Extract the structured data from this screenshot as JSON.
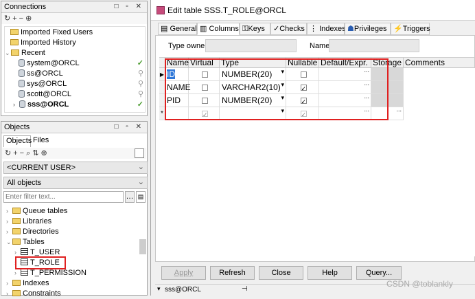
{
  "connections": {
    "title": "Connections",
    "panel_buttons": "□ ▫ ✕",
    "items": [
      {
        "label": "Imported Fixed Users"
      },
      {
        "label": "Imported History"
      },
      {
        "label": "Recent"
      },
      {
        "label": "system@ORCL"
      },
      {
        "label": "ss@ORCL"
      },
      {
        "label": "sys@ORCL"
      },
      {
        "label": "scott@ORCL"
      },
      {
        "label": "sss@ORCL"
      }
    ]
  },
  "objects": {
    "title": "Objects",
    "tabs": [
      "Objects",
      "Files"
    ],
    "user_combo": "<CURRENT USER>",
    "scope_combo": "All objects",
    "filter_placeholder": "Enter filter text...",
    "tree": [
      {
        "label": "Queue tables"
      },
      {
        "label": "Libraries"
      },
      {
        "label": "Directories"
      },
      {
        "label": "Tables"
      },
      {
        "label": "T_USER"
      },
      {
        "label": "T_ROLE"
      },
      {
        "label": "T_PERMISSION"
      },
      {
        "label": "Indexes"
      },
      {
        "label": "Constraints"
      }
    ]
  },
  "editor": {
    "title": "Edit table SSS.T_ROLE@ORCL",
    "tabs": [
      "General",
      "Columns",
      "Keys",
      "Checks",
      "Indexes",
      "Privileges",
      "Triggers"
    ],
    "type_owner_label": "Type owner",
    "name_label": "Name",
    "columns": [
      "Name",
      "Virtual",
      "Type",
      "Nullable",
      "Default/Expr.",
      "Storage",
      "Comments"
    ],
    "rows": [
      {
        "name": "ID",
        "virtual": false,
        "type": "NUMBER(20)",
        "nullable": false
      },
      {
        "name": "NAME",
        "virtual": false,
        "type": "VARCHAR2(10)",
        "nullable": true
      },
      {
        "name": "PID",
        "virtual": false,
        "type": "NUMBER(20)",
        "nullable": true
      },
      {
        "name": "",
        "virtual": true,
        "type": "",
        "nullable": true
      }
    ],
    "buttons": {
      "apply": "Apply",
      "refresh": "Refresh",
      "close": "Close",
      "help": "Help",
      "query": "Query..."
    },
    "status_conn": "sss@ORCL",
    "watermark": "CSDN @toblankly"
  }
}
